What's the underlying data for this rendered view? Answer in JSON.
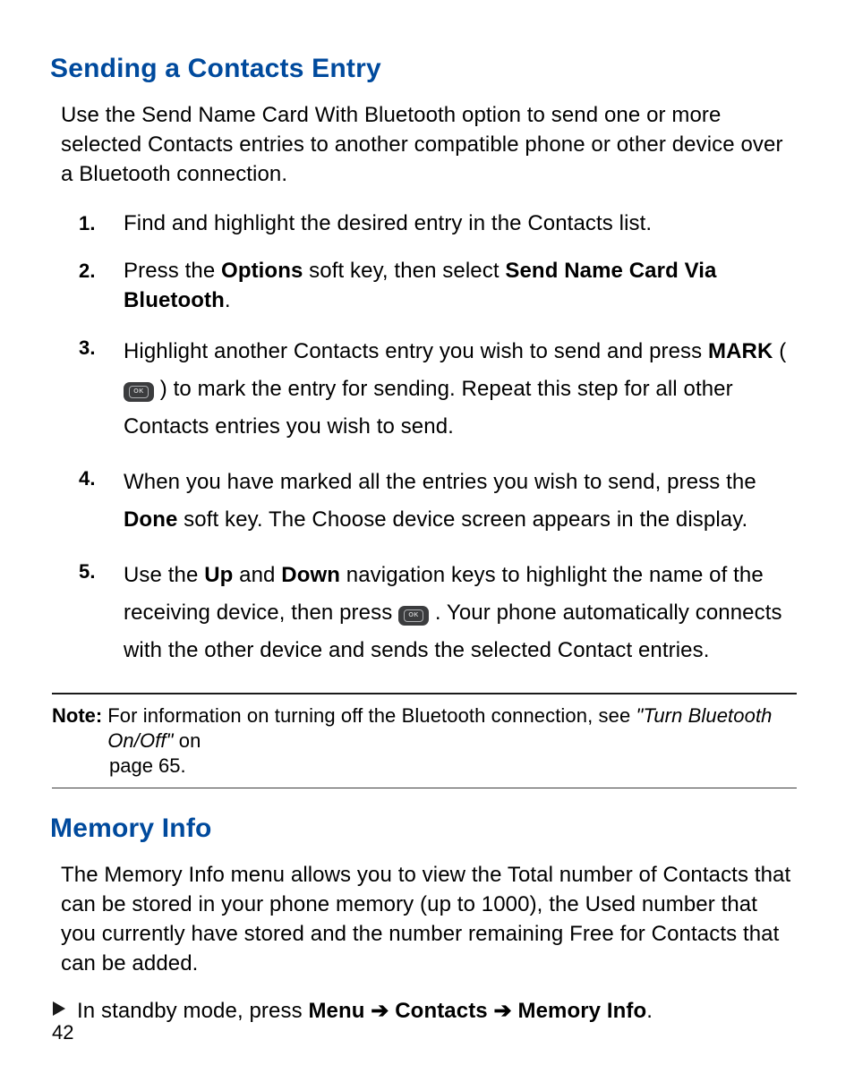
{
  "section1": {
    "title": "Sending a Contacts Entry",
    "intro": "Use the Send Name Card With Bluetooth option to send one or more selected Contacts entries to another compatible phone or other device over a Bluetooth connection.",
    "steps": [
      {
        "num": "1.",
        "parts": [
          {
            "t": "Find and highlight the desired entry in the Contacts list."
          }
        ]
      },
      {
        "num": "2.",
        "parts": [
          {
            "t": "Press the "
          },
          {
            "t": "Options",
            "bold": true
          },
          {
            "t": " soft key, then select "
          },
          {
            "t": "Send Name Card Via Bluetooth",
            "bold": true
          },
          {
            "t": "."
          }
        ]
      },
      {
        "num": "3.",
        "parts": [
          {
            "t": "Highlight another Contacts entry you wish to send and press "
          },
          {
            "t": "MARK",
            "bold": true
          },
          {
            "t": " ( "
          },
          {
            "icon": "ok"
          },
          {
            "t": " ) to mark the entry for sending. Repeat this step for all other Contacts entries you wish to send."
          }
        ]
      },
      {
        "num": "4.",
        "parts": [
          {
            "t": "When you have marked all the entries you wish to send, press the "
          },
          {
            "t": "Done",
            "bold": true
          },
          {
            "t": " soft key. The Choose device screen appears in the display."
          }
        ]
      },
      {
        "num": "5.",
        "parts": [
          {
            "t": "Use the "
          },
          {
            "t": "Up",
            "bold": true
          },
          {
            "t": " and "
          },
          {
            "t": "Down",
            "bold": true
          },
          {
            "t": " navigation keys to highlight the name of the receiving device, then press "
          },
          {
            "icon": "ok"
          },
          {
            "t": " . Your phone automatically connects with the other device and sends the selected Contact entries."
          }
        ]
      }
    ]
  },
  "note": {
    "label": "Note:",
    "line": "For information on turning off the Bluetooth connection, see ",
    "italic": "\"Turn Bluetooth On/Off\"",
    "tail": " on",
    "line2": "page 65."
  },
  "section2": {
    "title": "Memory Info",
    "intro": "The Memory Info menu allows you to view the Total number of Contacts that can be stored in your phone memory (up to 1000), the Used number that you currently have stored and the number remaining Free for Contacts that can be added.",
    "bullet": {
      "pre": "In standby mode, press ",
      "menu": "Menu",
      "arrow": " ➔ ",
      "contacts": "Contacts",
      "meminfo": "Memory Info",
      "dot": "."
    }
  },
  "pageNumber": "42",
  "icons": {
    "ok_label": "OK"
  }
}
